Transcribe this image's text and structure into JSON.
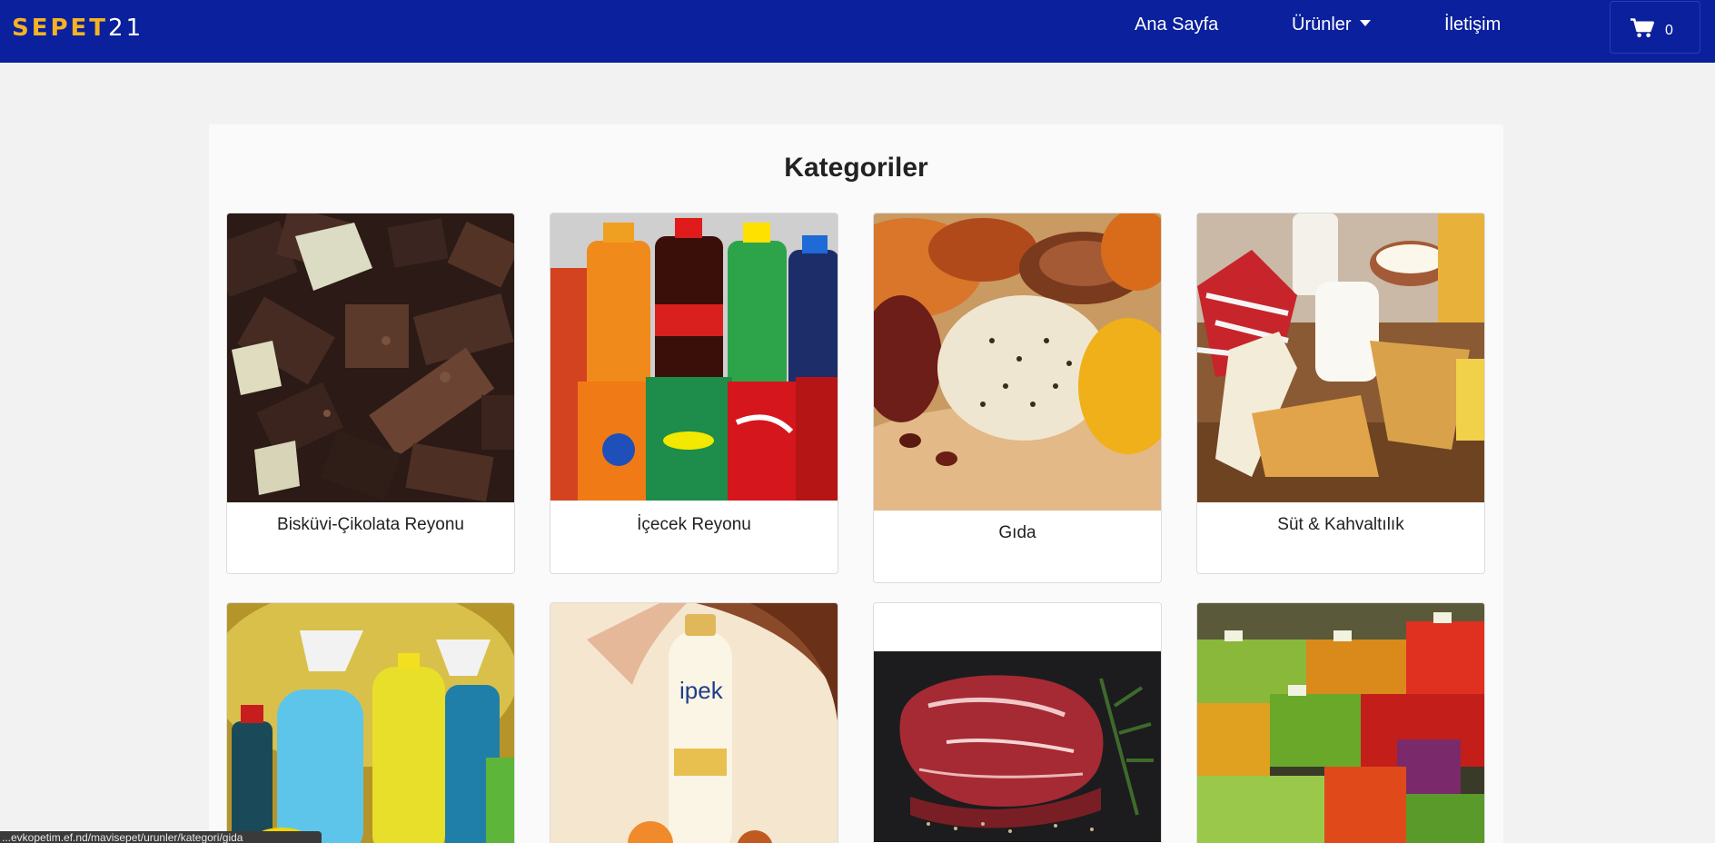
{
  "nav": {
    "brand_part1": "SEPET",
    "brand_part2": "21",
    "home": "Ana Sayfa",
    "products": "Ürünler",
    "contact": "İletişim",
    "cart_count": "0"
  },
  "main": {
    "heading": "Kategoriler",
    "categories": [
      {
        "label": "Bisküvi-Çikolata Reyonu"
      },
      {
        "label": "İçecek Reyonu"
      },
      {
        "label": "Gıda"
      },
      {
        "label": "Süt & Kahvaltılık"
      },
      {
        "label": ""
      },
      {
        "label": ""
      },
      {
        "label": ""
      },
      {
        "label": ""
      }
    ]
  },
  "status_bar": {
    "url": "...evkopetim.ef.nd/mavisepet/urunler/kategori/gida"
  },
  "colors": {
    "navbar": "#0a209c",
    "brand_accent": "#f5b323",
    "page_bg": "#f2f2f2"
  }
}
